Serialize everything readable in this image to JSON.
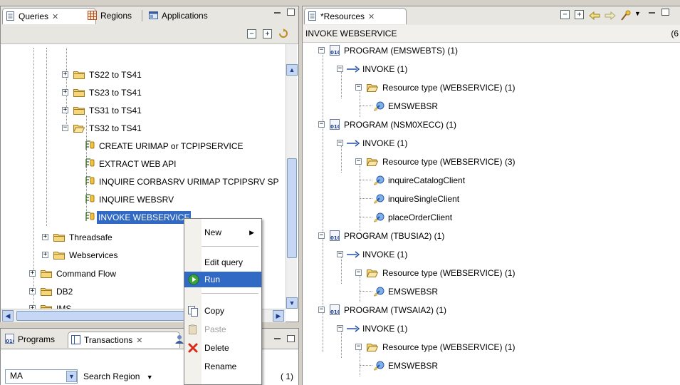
{
  "left_view": {
    "tabs": [
      {
        "label": "Queries",
        "close": "✕",
        "active": true
      },
      {
        "label": "Regions",
        "active": false
      },
      {
        "label": "Applications",
        "active": false
      }
    ],
    "tree": [
      {
        "label": "TS22 to TS41",
        "expanded": false
      },
      {
        "label": "TS23 to TS41",
        "expanded": false
      },
      {
        "label": "TS31 to TS41",
        "expanded": false
      },
      {
        "label": "TS32 to TS41",
        "expanded": true
      },
      {
        "label": "CREATE URIMAP or TCPIPSERVICE"
      },
      {
        "label": "EXTRACT WEB API"
      },
      {
        "label": "INQUIRE CORBASRV URIMAP TCPIPSRV SP"
      },
      {
        "label": "INQUIRE WEBSRV"
      },
      {
        "label": "INVOKE WEBSERVICE",
        "selected": true
      },
      {
        "label": "Threadsafe",
        "expanded": false
      },
      {
        "label": "Webservices",
        "expanded": false
      },
      {
        "label": "Command Flow",
        "expanded": false
      },
      {
        "label": "DB2",
        "expanded": false
      },
      {
        "label": "IMS",
        "expanded": false
      }
    ]
  },
  "bottom_view": {
    "tabs": [
      {
        "label": "Programs",
        "active": false
      },
      {
        "label": "Transactions",
        "close": "✕",
        "active": true
      }
    ],
    "filter_value": "MA",
    "search_label": "Search Region",
    "count": "( 1)"
  },
  "context_menu": {
    "items": [
      {
        "label": "New",
        "submenu": true
      },
      {
        "label": "Edit query"
      },
      {
        "label": "Run",
        "highlighted": true
      },
      {
        "label": "Copy"
      },
      {
        "label": "Paste",
        "disabled": true
      },
      {
        "label": "Delete"
      },
      {
        "label": "Rename"
      }
    ]
  },
  "resources_view": {
    "tab_label": "*Resources",
    "tab_close": "✕",
    "header_title": "INVOKE WEBSERVICE",
    "header_count": "(6",
    "tree": [
      {
        "label": "PROGRAM (EMSWEBTS)  (1)"
      },
      {
        "label": "INVOKE  (1)"
      },
      {
        "label": "Resource type (WEBSERVICE)  (1)"
      },
      {
        "label": "EMSWEBSR"
      },
      {
        "label": "PROGRAM (NSM0XECC)  (1)"
      },
      {
        "label": "INVOKE  (1)"
      },
      {
        "label": "Resource type (WEBSERVICE)  (3)"
      },
      {
        "label": "inquireCatalogClient"
      },
      {
        "label": "inquireSingleClient"
      },
      {
        "label": "placeOrderClient"
      },
      {
        "label": "PROGRAM (TBUSIA2)  (1)"
      },
      {
        "label": "INVOKE  (1)"
      },
      {
        "label": "Resource type (WEBSERVICE)  (1)"
      },
      {
        "label": "EMSWEBSR"
      },
      {
        "label": "PROGRAM (TWSAIA2)  (1)"
      },
      {
        "label": "INVOKE  (1)"
      },
      {
        "label": "Resource type (WEBSERVICE)  (1)"
      },
      {
        "label": "EMSWEBSR"
      }
    ]
  },
  "colors": {
    "selection": "#316ac5",
    "folder": "#f2c94c",
    "window_bg": "#d4d0c8"
  }
}
